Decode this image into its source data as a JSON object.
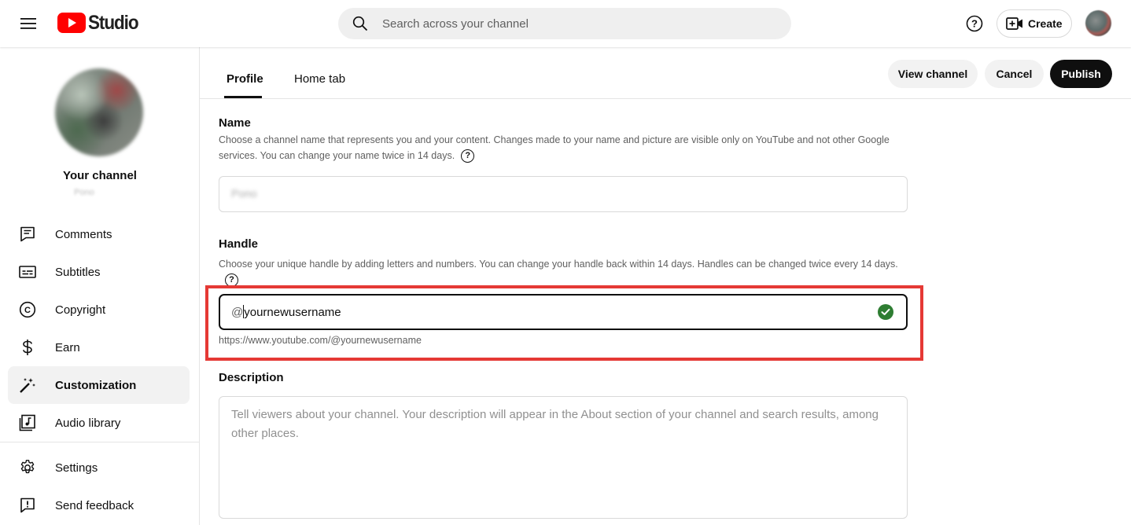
{
  "header": {
    "logo_text": "Studio",
    "search_placeholder": "Search across your channel",
    "create_label": "Create",
    "icons": [
      "menu-icon",
      "youtube-logo-icon",
      "search-icon",
      "help-icon",
      "create-video-icon",
      "avatar"
    ]
  },
  "sidebar": {
    "channel_title": "Your channel",
    "channel_name": "Pono",
    "items": [
      {
        "label": "Comments",
        "icon": "comments-icon",
        "active": false
      },
      {
        "label": "Subtitles",
        "icon": "subtitles-icon",
        "active": false
      },
      {
        "label": "Copyright",
        "icon": "copyright-icon",
        "active": false
      },
      {
        "label": "Earn",
        "icon": "dollar-icon",
        "active": false
      },
      {
        "label": "Customization",
        "icon": "magic-wand-icon",
        "active": true
      },
      {
        "label": "Audio library",
        "icon": "audio-library-icon",
        "active": false
      },
      {
        "label": "Settings",
        "icon": "gear-icon",
        "active": false
      },
      {
        "label": "Send feedback",
        "icon": "feedback-icon",
        "active": false
      }
    ]
  },
  "main": {
    "tabs": [
      {
        "label": "Profile",
        "active": true
      },
      {
        "label": "Home tab",
        "active": false
      }
    ],
    "actions": {
      "view_channel": "View channel",
      "cancel": "Cancel",
      "publish": "Publish"
    },
    "name_section": {
      "title": "Name",
      "description": "Choose a channel name that represents you and your content. Changes made to your name and picture are visible only on YouTube and not other Google services. You can change your name twice in 14 days.",
      "value": "Pono"
    },
    "handle_section": {
      "title": "Handle",
      "description": "Choose your unique handle by adding letters and numbers. You can change your handle back within 14 days. Handles can be changed twice every 14 days.",
      "prefix": "@",
      "value": "yournewusername",
      "url": "https://www.youtube.com/@yournewusername",
      "status": "available"
    },
    "description_section": {
      "title": "Description",
      "placeholder": "Tell viewers about your channel. Your description will appear in the About section of your channel and search results, among other places."
    }
  },
  "colors": {
    "publish_bg": "#0f0f0f",
    "highlight_box": "#e53935",
    "check_green": "#2e7d32",
    "youtube_red": "#ff0000"
  }
}
